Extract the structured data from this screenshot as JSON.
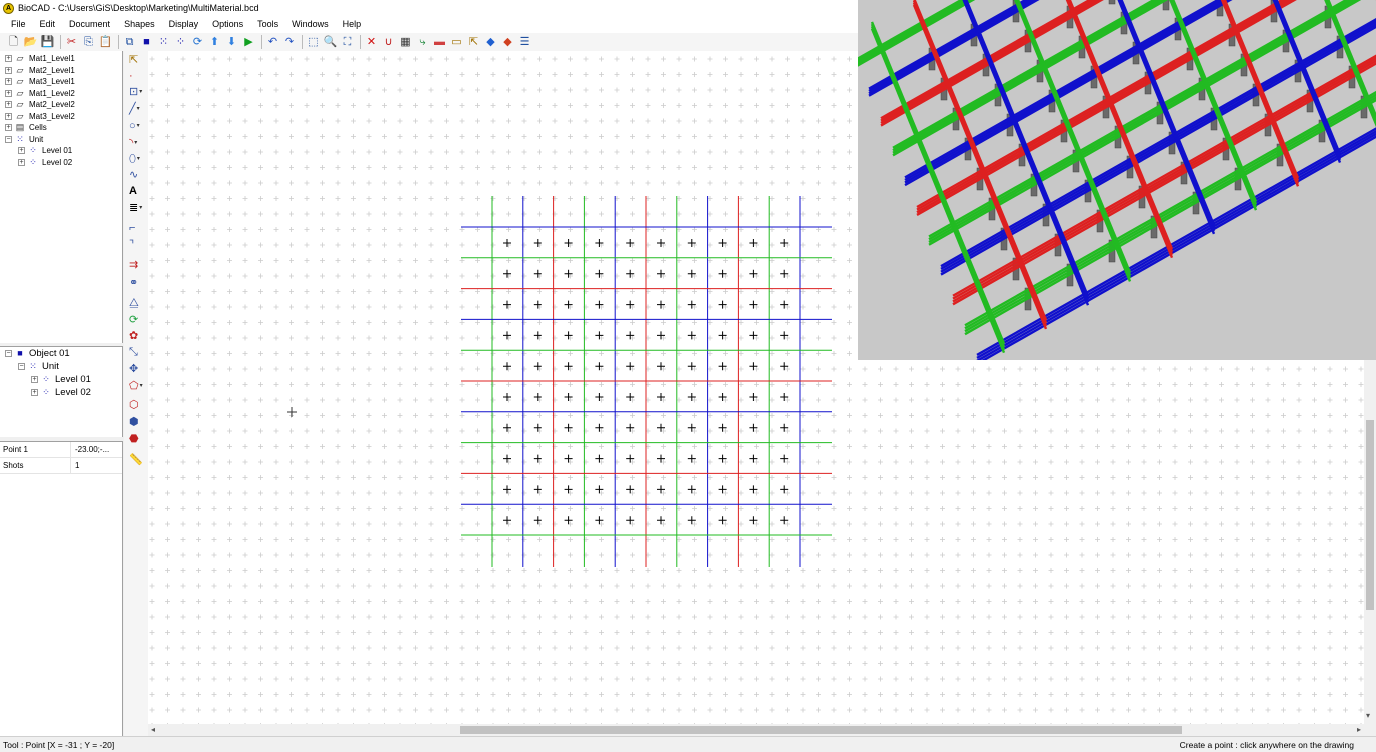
{
  "window": {
    "title": "BioCAD - C:\\Users\\GiS\\Desktop\\Marketing\\MultiMaterial.bcd"
  },
  "menu": [
    "File",
    "Edit",
    "Document",
    "Shapes",
    "Display",
    "Options",
    "Tools",
    "Windows",
    "Help"
  ],
  "toolbar": {
    "icons": [
      "new-icon",
      "open-icon",
      "save-icon",
      "sep",
      "cut-icon",
      "copy-icon",
      "paste-icon",
      "sep",
      "layers-icon",
      "square-icon",
      "grid-icon",
      "points-icon",
      "refresh-icon",
      "arrow-up-icon",
      "arrow-down-icon",
      "play-icon",
      "sep",
      "undo-icon",
      "redo-icon",
      "sep",
      "zoom-window-icon",
      "zoom-icon",
      "zoom-fit-icon",
      "sep",
      "delete-icon",
      "magnet-icon",
      "hatch-icon",
      "path-icon",
      "tape-icon",
      "folder-icon",
      "select-icon",
      "layer-blue-icon",
      "layer-red-icon",
      "list-icon"
    ]
  },
  "tree": {
    "items": [
      {
        "label": "Mat1_Level1",
        "indent": 0,
        "icon": "material-icon"
      },
      {
        "label": "Mat2_Level1",
        "indent": 0,
        "icon": "material-icon"
      },
      {
        "label": "Mat3_Level1",
        "indent": 0,
        "icon": "material-icon"
      },
      {
        "label": "Mat1_Level2",
        "indent": 0,
        "icon": "material-icon"
      },
      {
        "label": "Mat2_Level2",
        "indent": 0,
        "icon": "material-icon"
      },
      {
        "label": "Mat3_Level2",
        "indent": 0,
        "icon": "material-icon"
      },
      {
        "label": "Cells",
        "indent": 0,
        "icon": "cells-icon"
      },
      {
        "label": "Unit",
        "indent": 0,
        "icon": "unit-icon",
        "expanded": true
      },
      {
        "label": "Level 01",
        "indent": 1,
        "icon": "level-icon"
      },
      {
        "label": "Level 02",
        "indent": 1,
        "icon": "level-icon"
      }
    ]
  },
  "objects": {
    "items": [
      {
        "label": "Object 01",
        "indent": 0,
        "icon": "object-icon",
        "expanded": true
      },
      {
        "label": "Unit",
        "indent": 1,
        "icon": "unit-icon",
        "expanded": true
      },
      {
        "label": "Level 01",
        "indent": 2,
        "icon": "level-icon"
      },
      {
        "label": "Level 02",
        "indent": 2,
        "icon": "level-icon"
      }
    ]
  },
  "properties": [
    {
      "key": "Point 1",
      "value": "-23.00;-..."
    },
    {
      "key": "Shots",
      "value": "1"
    }
  ],
  "vtools": [
    {
      "name": "select-tool-icon",
      "glyph": "⇱",
      "color": "#a07000",
      "dd": false
    },
    {
      "name": "point-tool-icon",
      "glyph": "·",
      "color": "#c02020",
      "dd": false
    },
    {
      "name": "rectangle-tool-icon",
      "glyph": "⊡",
      "color": "#3050a0",
      "dd": true
    },
    {
      "name": "line-tool-icon",
      "glyph": "╱",
      "color": "#3050a0",
      "dd": true
    },
    {
      "name": "circle-tool-icon",
      "glyph": "○",
      "color": "#3050a0",
      "dd": true
    },
    {
      "name": "arc-tool-icon",
      "glyph": "◝",
      "color": "#c02020",
      "dd": true
    },
    {
      "name": "ellipse-tool-icon",
      "glyph": "⬯",
      "color": "#3050a0",
      "dd": true
    },
    {
      "name": "spline-tool-icon",
      "glyph": "∿",
      "color": "#3050a0",
      "dd": false
    },
    {
      "name": "text-tool-icon",
      "glyph": "A",
      "color": "#000000",
      "dd": false
    },
    {
      "name": "hatch-tool-icon",
      "glyph": "≣",
      "color": "#000000",
      "dd": true
    },
    {
      "name": "fillet-tool-icon",
      "glyph": "⌐",
      "color": "#3050a0",
      "dd": false
    },
    {
      "name": "chamfer-tool-icon",
      "glyph": "⌝",
      "color": "#3050a0",
      "dd": false
    },
    {
      "name": "extend-tool-icon",
      "glyph": "⇉",
      "color": "#c02020",
      "dd": false
    },
    {
      "name": "link-tool-icon",
      "glyph": "⚭",
      "color": "#3050a0",
      "dd": false
    },
    {
      "name": "mirror-tool-icon",
      "glyph": "⧋",
      "color": "#3050a0",
      "dd": false
    },
    {
      "name": "rotate-tool-icon",
      "glyph": "⟳",
      "color": "#20a040",
      "dd": false
    },
    {
      "name": "array-tool-icon",
      "glyph": "✿",
      "color": "#c02020",
      "dd": false
    },
    {
      "name": "scale-tool-icon",
      "glyph": "⤡",
      "color": "#3050a0",
      "dd": false
    },
    {
      "name": "move-tool-icon",
      "glyph": "✥",
      "color": "#3050a0",
      "dd": false
    },
    {
      "name": "offset-tool-icon",
      "glyph": "⬠",
      "color": "#c02020",
      "dd": true
    },
    {
      "name": "trim-tool-icon",
      "glyph": "⬡",
      "color": "#c02020",
      "dd": false
    },
    {
      "name": "boolean-tool-icon",
      "glyph": "⬢",
      "color": "#3050a0",
      "dd": false
    },
    {
      "name": "explode-tool-icon",
      "glyph": "⬣",
      "color": "#c02020",
      "dd": false
    },
    {
      "name": "measure-tool-icon",
      "glyph": "📏",
      "color": "#333333",
      "dd": false
    }
  ],
  "colors": {
    "mat_green": "#22bb22",
    "mat_red": "#dd2020",
    "mat_blue": "#1010cc",
    "grid_cross": "#cccccc",
    "preview_bg": "#c8c8c8"
  },
  "status": {
    "left": "Tool : Point  [X = -31 ; Y = -20]",
    "right": "Create a point : click anywhere on the drawing"
  }
}
